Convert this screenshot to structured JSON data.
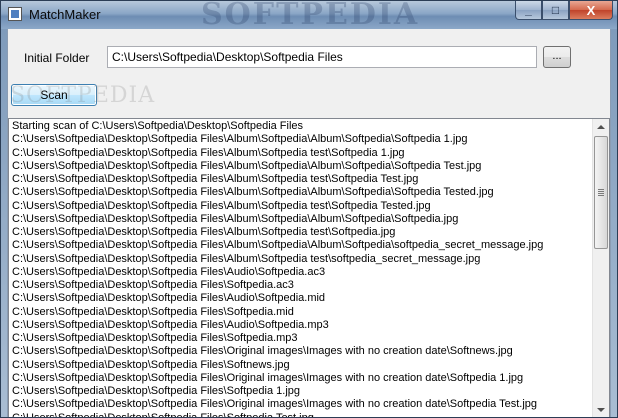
{
  "window": {
    "title": "MatchMaker",
    "watermark": "SOFTPEDIA",
    "minimize_glyph": "_",
    "maximize_glyph": "□",
    "close_glyph": "X"
  },
  "form": {
    "folder_label": "Initial Folder",
    "folder_value": "C:\\Users\\Softpedia\\Desktop\\Softpedia Files",
    "browse_label": "...",
    "scan_label": "Scan",
    "scan_watermark": "SOFTPEDIA"
  },
  "log": {
    "lines": [
      "Starting scan of C:\\Users\\Softpedia\\Desktop\\Softpedia Files",
      "C:\\Users\\Softpedia\\Desktop\\Softpedia Files\\Album\\Softpedia\\Album\\Softpedia\\Softpedia 1.jpg",
      "C:\\Users\\Softpedia\\Desktop\\Softpedia Files\\Album\\Softpedia test\\Softpedia 1.jpg",
      "C:\\Users\\Softpedia\\Desktop\\Softpedia Files\\Album\\Softpedia\\Album\\Softpedia\\Softpedia Test.jpg",
      "C:\\Users\\Softpedia\\Desktop\\Softpedia Files\\Album\\Softpedia test\\Softpedia Test.jpg",
      "C:\\Users\\Softpedia\\Desktop\\Softpedia Files\\Album\\Softpedia\\Album\\Softpedia\\Softpedia Tested.jpg",
      "C:\\Users\\Softpedia\\Desktop\\Softpedia Files\\Album\\Softpedia test\\Softpedia Tested.jpg",
      "C:\\Users\\Softpedia\\Desktop\\Softpedia Files\\Album\\Softpedia\\Album\\Softpedia\\Softpedia.jpg",
      "C:\\Users\\Softpedia\\Desktop\\Softpedia Files\\Album\\Softpedia test\\Softpedia.jpg",
      "C:\\Users\\Softpedia\\Desktop\\Softpedia Files\\Album\\Softpedia\\Album\\Softpedia\\softpedia_secret_message.jpg",
      "C:\\Users\\Softpedia\\Desktop\\Softpedia Files\\Album\\Softpedia test\\softpedia_secret_message.jpg",
      "C:\\Users\\Softpedia\\Desktop\\Softpedia Files\\Audio\\Softpedia.ac3",
      "C:\\Users\\Softpedia\\Desktop\\Softpedia Files\\Softpedia.ac3",
      "C:\\Users\\Softpedia\\Desktop\\Softpedia Files\\Audio\\Softpedia.mid",
      "C:\\Users\\Softpedia\\Desktop\\Softpedia Files\\Softpedia.mid",
      "C:\\Users\\Softpedia\\Desktop\\Softpedia Files\\Audio\\Softpedia.mp3",
      "C:\\Users\\Softpedia\\Desktop\\Softpedia Files\\Softpedia.mp3",
      "C:\\Users\\Softpedia\\Desktop\\Softpedia Files\\Original images\\Images with no creation date\\Softnews.jpg",
      "C:\\Users\\Softpedia\\Desktop\\Softpedia Files\\Softnews.jpg",
      "C:\\Users\\Softpedia\\Desktop\\Softpedia Files\\Original images\\Images with no creation date\\Softpedia 1.jpg",
      "C:\\Users\\Softpedia\\Desktop\\Softpedia Files\\Softpedia 1.jpg",
      "C:\\Users\\Softpedia\\Desktop\\Softpedia Files\\Original images\\Images with no creation date\\Softpedia Test.jpg",
      "C:\\Users\\Softpedia\\Desktop\\Softpedia Files\\Softpedia Test.jpg"
    ]
  }
}
